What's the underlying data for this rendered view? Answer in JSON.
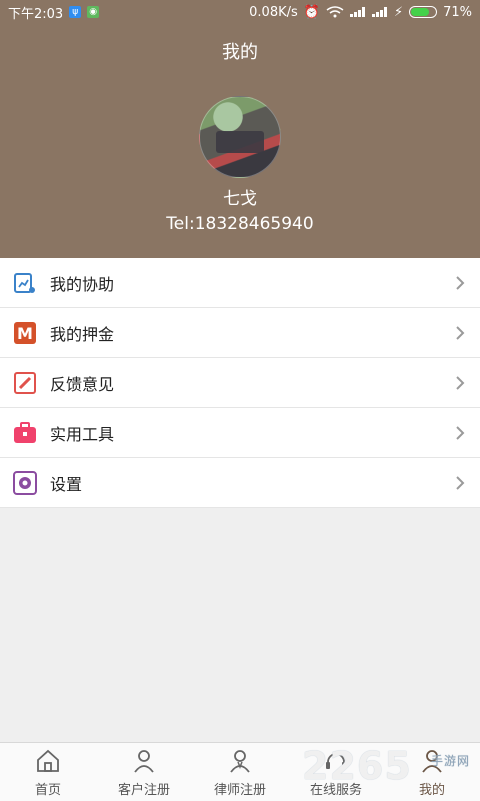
{
  "status_bar": {
    "time": "下午2:03",
    "speed": "0.08K/s",
    "battery": "71%"
  },
  "header": {
    "title": "我的",
    "user_name": "七戈",
    "tel": "Tel:18328465940"
  },
  "menu": [
    {
      "label": "我的协助",
      "icon": "assist-icon",
      "color": "#3a82c9"
    },
    {
      "label": "我的押金",
      "icon": "deposit-icon",
      "color": "#d4512a"
    },
    {
      "label": "反馈意见",
      "icon": "feedback-icon",
      "color": "#e0524c"
    },
    {
      "label": "实用工具",
      "icon": "toolbox-icon",
      "color": "#f0426c"
    },
    {
      "label": "设置",
      "icon": "settings-icon",
      "color": "#8b4ca0"
    }
  ],
  "bottom_nav": [
    {
      "label": "首页",
      "icon": "home-icon"
    },
    {
      "label": "客户注册",
      "icon": "client-register-icon"
    },
    {
      "label": "律师注册",
      "icon": "lawyer-register-icon"
    },
    {
      "label": "在线服务",
      "icon": "online-service-icon"
    },
    {
      "label": "我的",
      "icon": "profile-icon"
    }
  ],
  "watermark": {
    "brand": "2265",
    "sub": "手游网"
  }
}
